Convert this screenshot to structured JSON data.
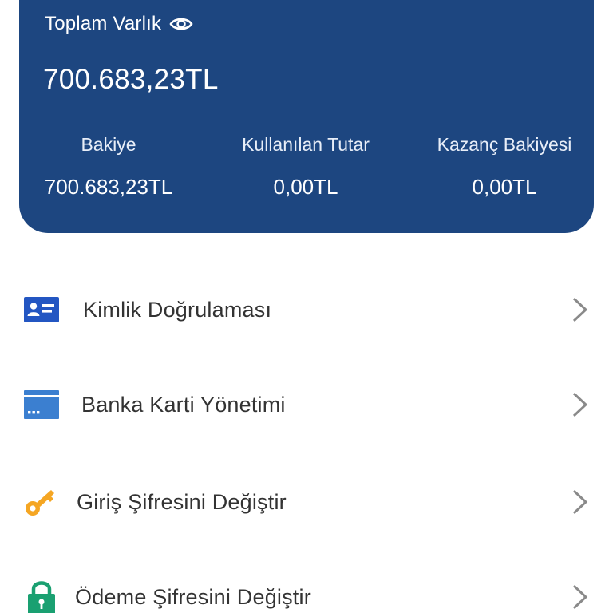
{
  "balance_card": {
    "total_label": "Toplam Varlık",
    "total_amount": "700.683,23TL",
    "stats": [
      {
        "label": "Bakiye",
        "value": "700.683,23TL"
      },
      {
        "label": "Kullanılan Tutar",
        "value": "0,00TL"
      },
      {
        "label": "Kazanç Bakiyesi",
        "value": "0,00TL"
      }
    ],
    "background_color": "#1d4680"
  },
  "menu": {
    "items": [
      {
        "label": "Kimlik Doğrulaması",
        "icon": "id-card-icon",
        "color": "#2356c2"
      },
      {
        "label": "Banka Karti Yönetimi",
        "icon": "bank-card-icon",
        "color": "#3b7fd0"
      },
      {
        "label": "Giriş Şifresini Değiştir",
        "icon": "key-icon",
        "color": "#f5a623"
      },
      {
        "label": "Ödeme Şifresini Değiştir",
        "icon": "lock-icon",
        "color": "#1aa071"
      }
    ],
    "chevron_color": "#8a8a8a"
  }
}
